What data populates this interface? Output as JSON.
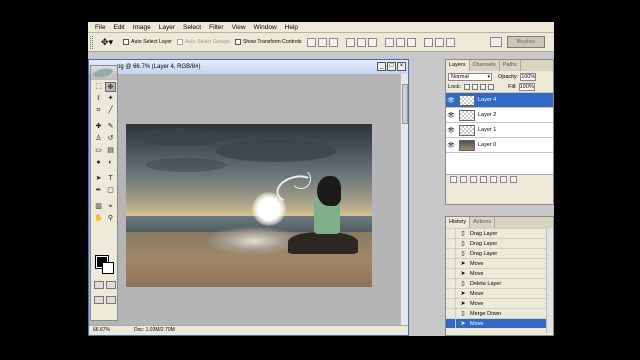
{
  "menubar": {
    "items": [
      "File",
      "Edit",
      "Image",
      "Layer",
      "Select",
      "Filter",
      "View",
      "Window",
      "Help"
    ]
  },
  "options": {
    "tool_icon": "move-tool-icon",
    "auto_select_layer": "Auto Select Layer",
    "auto_select_groups": "Auto Select Groups",
    "show_transform_controls": "Show Transform Controls",
    "brushes_label": "Brushes"
  },
  "document": {
    "title": "pg @ 66.7% (Layer 4, RGB/8#)",
    "zoom": "66.67%",
    "doc_size": "Doc: 1.03M/2.70M"
  },
  "layers_panel": {
    "tabs": [
      "Layers",
      "Channels",
      "Paths"
    ],
    "blend_mode": "Normal",
    "opacity_label": "Opacity:",
    "opacity_value": "100%",
    "lock_label": "Lock:",
    "fill_label": "Fill:",
    "fill_value": "100%",
    "layers": [
      {
        "name": "Layer 4",
        "selected": true
      },
      {
        "name": "Layer 2",
        "selected": false
      },
      {
        "name": "Layer 1",
        "selected": false
      },
      {
        "name": "Layer 0",
        "selected": false
      }
    ]
  },
  "history_panel": {
    "tabs": [
      "History",
      "Actions"
    ],
    "items": [
      {
        "label": "Drag Layer",
        "icon": "layer-icon"
      },
      {
        "label": "Drag Layer",
        "icon": "layer-icon"
      },
      {
        "label": "Drag Layer",
        "icon": "layer-icon"
      },
      {
        "label": "Move",
        "icon": "move-icon"
      },
      {
        "label": "Move",
        "icon": "move-icon"
      },
      {
        "label": "Delete Layer",
        "icon": "layer-icon"
      },
      {
        "label": "Move",
        "icon": "move-icon"
      },
      {
        "label": "Move",
        "icon": "move-icon"
      },
      {
        "label": "Merge Down",
        "icon": "layer-icon"
      },
      {
        "label": "Move",
        "icon": "move-icon",
        "selected": true
      }
    ]
  },
  "colors": {
    "selection": "#316ac5",
    "chrome": "#ece9d8",
    "foreground": "#000000",
    "background": "#ffffff"
  }
}
